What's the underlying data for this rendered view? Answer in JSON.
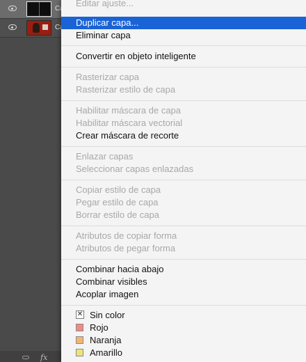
{
  "layers_panel": {
    "layers": [
      {
        "name": "Ca",
        "thumbnail": "black-image"
      },
      {
        "name": "Ca",
        "thumbnail": "red-photo"
      }
    ],
    "footer": {
      "fx_label": "fx"
    }
  },
  "menu": {
    "items": [
      {
        "label": "Editar ajuste...",
        "enabled": false
      },
      {
        "label": "Duplicar capa...",
        "enabled": true,
        "highlighted": true
      },
      {
        "label": "Eliminar capa",
        "enabled": true
      },
      {
        "label": "Convertir en objeto inteligente",
        "enabled": true
      },
      {
        "label": "Rasterizar capa",
        "enabled": false
      },
      {
        "label": "Rasterizar estilo de capa",
        "enabled": false
      },
      {
        "label": "Habilitar máscara de capa",
        "enabled": false
      },
      {
        "label": "Habilitar máscara vectorial",
        "enabled": false
      },
      {
        "label": "Crear máscara de recorte",
        "enabled": true
      },
      {
        "label": "Enlazar capas",
        "enabled": false
      },
      {
        "label": "Seleccionar capas enlazadas",
        "enabled": false
      },
      {
        "label": "Copiar estilo de capa",
        "enabled": false
      },
      {
        "label": "Pegar estilo de capa",
        "enabled": false
      },
      {
        "label": "Borrar estilo de capa",
        "enabled": false
      },
      {
        "label": "Atributos de copiar forma",
        "enabled": false
      },
      {
        "label": "Atributos de pegar forma",
        "enabled": false
      },
      {
        "label": "Combinar hacia abajo",
        "enabled": true
      },
      {
        "label": "Combinar visibles",
        "enabled": true
      },
      {
        "label": "Acoplar imagen",
        "enabled": true
      }
    ],
    "colors": [
      {
        "label": "Sin color",
        "swatch": null,
        "checked": true
      },
      {
        "label": "Rojo",
        "swatch": "#f08a86"
      },
      {
        "label": "Naranja",
        "swatch": "#f6b56e"
      },
      {
        "label": "Amarillo",
        "swatch": "#eee37a"
      }
    ]
  },
  "colors": {
    "highlight": "#1a63d6",
    "disabled_text": "#a8a8a8"
  }
}
